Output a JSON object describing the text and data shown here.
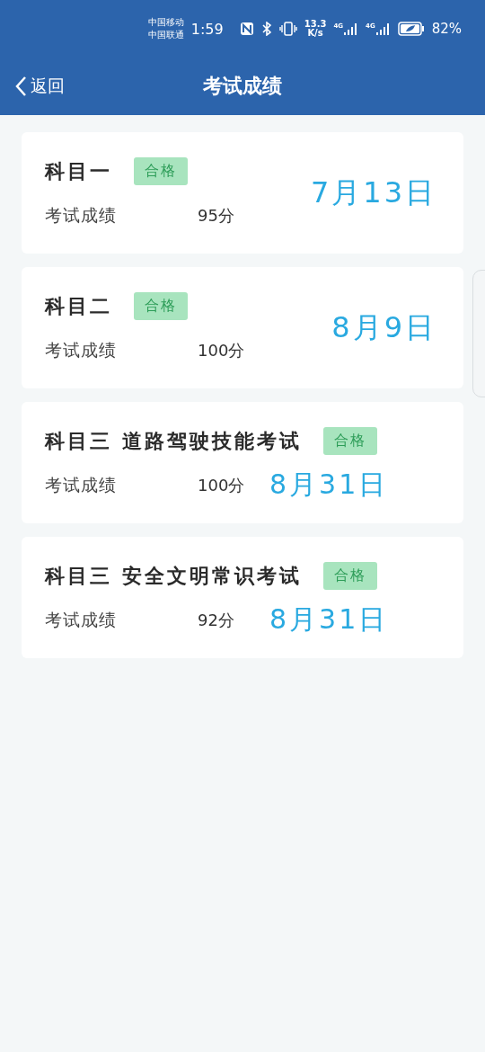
{
  "status_bar": {
    "carriers": [
      "中国移动",
      "中国联通"
    ],
    "time": "1:59",
    "net_speed": [
      "13.3",
      "K/s"
    ],
    "network_labels": [
      "4G",
      "4G"
    ],
    "battery": "82%"
  },
  "nav": {
    "back": "返回",
    "title": "考试成绩"
  },
  "results": [
    {
      "kind": "side",
      "subject": "科目一",
      "badge": "合格",
      "score_label": "考试成绩",
      "score": "95分",
      "date": "7月13日"
    },
    {
      "kind": "side",
      "subject": "科目二",
      "badge": "合格",
      "score_label": "考试成绩",
      "score": "100分",
      "date": "8月9日"
    },
    {
      "kind": "inline",
      "subject": "科目三 道路驾驶技能考试",
      "badge": "合格",
      "score_label": "考试成绩",
      "score": "100分",
      "date": "8月31日"
    },
    {
      "kind": "inline",
      "subject": "科目三 安全文明常识考试",
      "badge": "合格",
      "score_label": "考试成绩",
      "score": "92分",
      "date": "8月31日"
    }
  ]
}
